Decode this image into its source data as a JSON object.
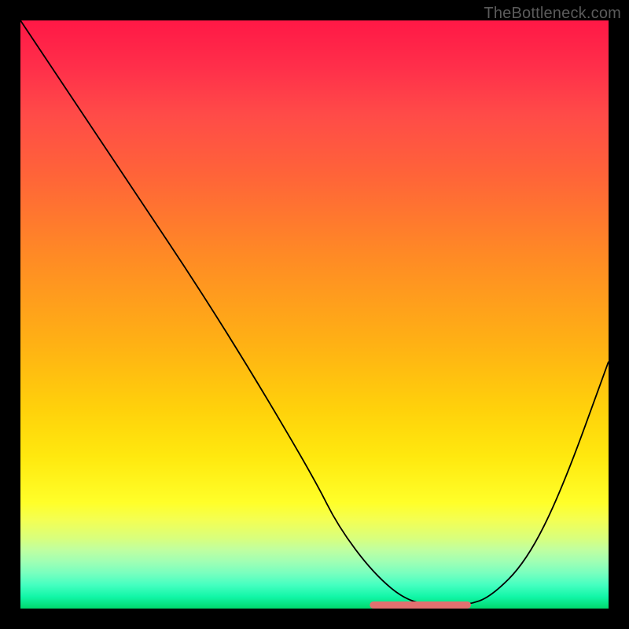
{
  "watermark": {
    "text": "TheBottleneck.com"
  },
  "chart_data": {
    "type": "line",
    "title": "",
    "xlabel": "",
    "ylabel": "",
    "xlim": [
      0,
      100
    ],
    "ylim": [
      0,
      100
    ],
    "grid": false,
    "legend": false,
    "series": [
      {
        "name": "bottleneck-curve",
        "x": [
          0,
          10,
          20,
          30,
          40,
          50,
          54,
          60,
          66,
          72,
          76,
          80,
          86,
          92,
          100
        ],
        "y": [
          100,
          85,
          70,
          55,
          39,
          22,
          14,
          6,
          1,
          0.6,
          0.6,
          2,
          8,
          20,
          42
        ],
        "color": "#000000"
      }
    ],
    "annotations": [
      {
        "name": "optimal-zone",
        "type": "segment",
        "x1": 60,
        "x2": 76,
        "y": 0.6,
        "color": "#e27070"
      }
    ],
    "background": {
      "type": "vertical-gradient",
      "stops": [
        {
          "pos": 0.0,
          "color": "#ff1846"
        },
        {
          "pos": 0.4,
          "color": "#ff8a25"
        },
        {
          "pos": 0.74,
          "color": "#ffe80e"
        },
        {
          "pos": 0.9,
          "color": "#c0ffa0"
        },
        {
          "pos": 1.0,
          "color": "#00d86d"
        }
      ]
    }
  }
}
